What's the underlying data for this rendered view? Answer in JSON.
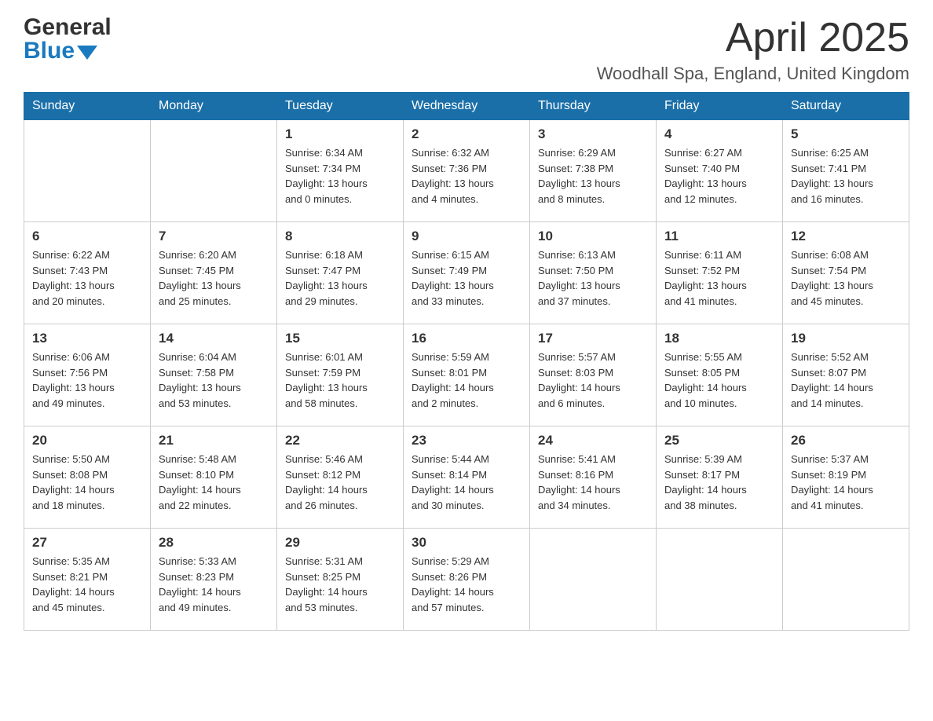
{
  "header": {
    "logo_general": "General",
    "logo_blue": "Blue",
    "title": "April 2025",
    "subtitle": "Woodhall Spa, England, United Kingdom"
  },
  "weekdays": [
    "Sunday",
    "Monday",
    "Tuesday",
    "Wednesday",
    "Thursday",
    "Friday",
    "Saturday"
  ],
  "weeks": [
    [
      {
        "day": "",
        "info": ""
      },
      {
        "day": "",
        "info": ""
      },
      {
        "day": "1",
        "info": "Sunrise: 6:34 AM\nSunset: 7:34 PM\nDaylight: 13 hours\nand 0 minutes."
      },
      {
        "day": "2",
        "info": "Sunrise: 6:32 AM\nSunset: 7:36 PM\nDaylight: 13 hours\nand 4 minutes."
      },
      {
        "day": "3",
        "info": "Sunrise: 6:29 AM\nSunset: 7:38 PM\nDaylight: 13 hours\nand 8 minutes."
      },
      {
        "day": "4",
        "info": "Sunrise: 6:27 AM\nSunset: 7:40 PM\nDaylight: 13 hours\nand 12 minutes."
      },
      {
        "day": "5",
        "info": "Sunrise: 6:25 AM\nSunset: 7:41 PM\nDaylight: 13 hours\nand 16 minutes."
      }
    ],
    [
      {
        "day": "6",
        "info": "Sunrise: 6:22 AM\nSunset: 7:43 PM\nDaylight: 13 hours\nand 20 minutes."
      },
      {
        "day": "7",
        "info": "Sunrise: 6:20 AM\nSunset: 7:45 PM\nDaylight: 13 hours\nand 25 minutes."
      },
      {
        "day": "8",
        "info": "Sunrise: 6:18 AM\nSunset: 7:47 PM\nDaylight: 13 hours\nand 29 minutes."
      },
      {
        "day": "9",
        "info": "Sunrise: 6:15 AM\nSunset: 7:49 PM\nDaylight: 13 hours\nand 33 minutes."
      },
      {
        "day": "10",
        "info": "Sunrise: 6:13 AM\nSunset: 7:50 PM\nDaylight: 13 hours\nand 37 minutes."
      },
      {
        "day": "11",
        "info": "Sunrise: 6:11 AM\nSunset: 7:52 PM\nDaylight: 13 hours\nand 41 minutes."
      },
      {
        "day": "12",
        "info": "Sunrise: 6:08 AM\nSunset: 7:54 PM\nDaylight: 13 hours\nand 45 minutes."
      }
    ],
    [
      {
        "day": "13",
        "info": "Sunrise: 6:06 AM\nSunset: 7:56 PM\nDaylight: 13 hours\nand 49 minutes."
      },
      {
        "day": "14",
        "info": "Sunrise: 6:04 AM\nSunset: 7:58 PM\nDaylight: 13 hours\nand 53 minutes."
      },
      {
        "day": "15",
        "info": "Sunrise: 6:01 AM\nSunset: 7:59 PM\nDaylight: 13 hours\nand 58 minutes."
      },
      {
        "day": "16",
        "info": "Sunrise: 5:59 AM\nSunset: 8:01 PM\nDaylight: 14 hours\nand 2 minutes."
      },
      {
        "day": "17",
        "info": "Sunrise: 5:57 AM\nSunset: 8:03 PM\nDaylight: 14 hours\nand 6 minutes."
      },
      {
        "day": "18",
        "info": "Sunrise: 5:55 AM\nSunset: 8:05 PM\nDaylight: 14 hours\nand 10 minutes."
      },
      {
        "day": "19",
        "info": "Sunrise: 5:52 AM\nSunset: 8:07 PM\nDaylight: 14 hours\nand 14 minutes."
      }
    ],
    [
      {
        "day": "20",
        "info": "Sunrise: 5:50 AM\nSunset: 8:08 PM\nDaylight: 14 hours\nand 18 minutes."
      },
      {
        "day": "21",
        "info": "Sunrise: 5:48 AM\nSunset: 8:10 PM\nDaylight: 14 hours\nand 22 minutes."
      },
      {
        "day": "22",
        "info": "Sunrise: 5:46 AM\nSunset: 8:12 PM\nDaylight: 14 hours\nand 26 minutes."
      },
      {
        "day": "23",
        "info": "Sunrise: 5:44 AM\nSunset: 8:14 PM\nDaylight: 14 hours\nand 30 minutes."
      },
      {
        "day": "24",
        "info": "Sunrise: 5:41 AM\nSunset: 8:16 PM\nDaylight: 14 hours\nand 34 minutes."
      },
      {
        "day": "25",
        "info": "Sunrise: 5:39 AM\nSunset: 8:17 PM\nDaylight: 14 hours\nand 38 minutes."
      },
      {
        "day": "26",
        "info": "Sunrise: 5:37 AM\nSunset: 8:19 PM\nDaylight: 14 hours\nand 41 minutes."
      }
    ],
    [
      {
        "day": "27",
        "info": "Sunrise: 5:35 AM\nSunset: 8:21 PM\nDaylight: 14 hours\nand 45 minutes."
      },
      {
        "day": "28",
        "info": "Sunrise: 5:33 AM\nSunset: 8:23 PM\nDaylight: 14 hours\nand 49 minutes."
      },
      {
        "day": "29",
        "info": "Sunrise: 5:31 AM\nSunset: 8:25 PM\nDaylight: 14 hours\nand 53 minutes."
      },
      {
        "day": "30",
        "info": "Sunrise: 5:29 AM\nSunset: 8:26 PM\nDaylight: 14 hours\nand 57 minutes."
      },
      {
        "day": "",
        "info": ""
      },
      {
        "day": "",
        "info": ""
      },
      {
        "day": "",
        "info": ""
      }
    ]
  ]
}
